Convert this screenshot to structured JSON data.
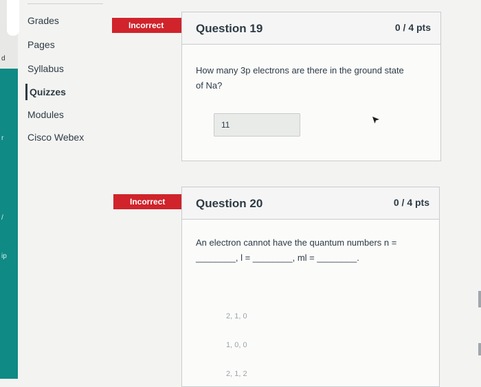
{
  "nav": {
    "items": [
      {
        "label": "Grades"
      },
      {
        "label": "Pages"
      },
      {
        "label": "Syllabus"
      },
      {
        "label": "Quizzes",
        "active": true
      },
      {
        "label": "Modules"
      },
      {
        "label": "Cisco Webex"
      }
    ]
  },
  "rail": {
    "glyph1": "d",
    "glyph2": "r",
    "glyph3": "ip",
    "glyph4": "/"
  },
  "questions": [
    {
      "status": "Incorrect",
      "title": "Question 19",
      "points": "0 / 4 pts",
      "text_line1": "How many 3p electrons are there in the ground state",
      "text_line2": "of Na?",
      "answer": "11"
    },
    {
      "status": "Incorrect",
      "title": "Question 20",
      "points": "0 / 4 pts",
      "text_line1": "An electron cannot have the quantum numbers n =",
      "text_line2": "________, l = ________, ml = ________.",
      "choices": [
        "2, 1, 0",
        "1, 0, 0",
        "2, 1, 2"
      ]
    }
  ],
  "colors": {
    "incorrect": "#d0232b",
    "rail": "#0f8a85"
  },
  "icons": {
    "cursor": "mouse-pointer-icon"
  }
}
